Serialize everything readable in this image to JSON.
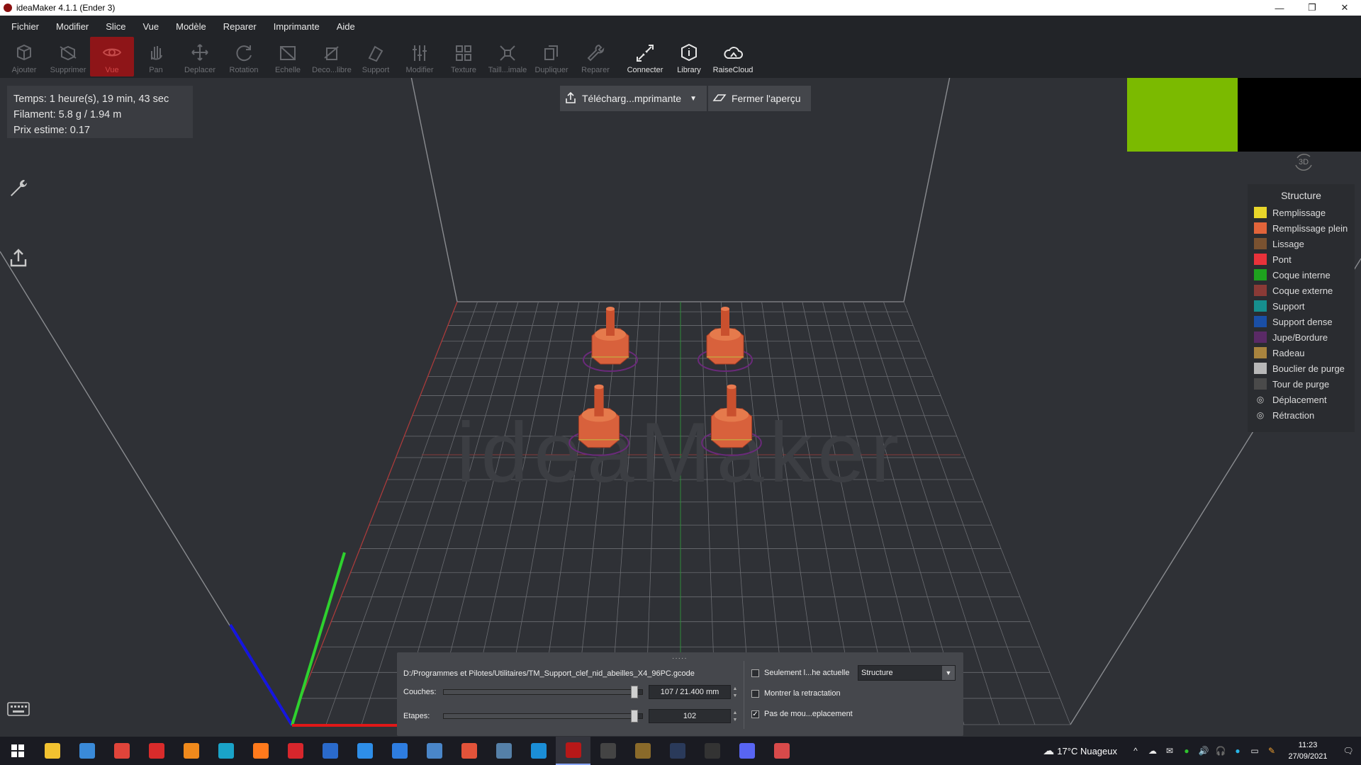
{
  "window": {
    "title": "ideaMaker 4.1.1 (Ender 3)",
    "controls": [
      "—",
      "❐",
      "✕"
    ]
  },
  "menu": [
    "Fichier",
    "Modifier",
    "Slice",
    "Vue",
    "Modèle",
    "Reparer",
    "Imprimante",
    "Aide"
  ],
  "toolbar": [
    {
      "label": "Ajouter",
      "icon": "add-model-icon",
      "state": "disabled"
    },
    {
      "label": "Supprimer",
      "icon": "delete-icon",
      "state": "disabled"
    },
    {
      "label": "Vue",
      "icon": "eye-icon",
      "state": "active"
    },
    {
      "label": "Pan",
      "icon": "hand-icon",
      "state": "disabled"
    },
    {
      "label": "Deplacer",
      "icon": "move-icon",
      "state": "disabled"
    },
    {
      "label": "Rotation",
      "icon": "rotate-icon",
      "state": "disabled"
    },
    {
      "label": "Echelle",
      "icon": "scale-icon",
      "state": "disabled"
    },
    {
      "label": "Deco...libre",
      "icon": "cut-icon",
      "state": "disabled"
    },
    {
      "label": "Support",
      "icon": "support-icon",
      "state": "disabled"
    },
    {
      "label": "Modifier",
      "icon": "sliders-icon",
      "state": "disabled"
    },
    {
      "label": "Texture",
      "icon": "texture-icon",
      "state": "disabled"
    },
    {
      "label": "Taill...imale",
      "icon": "minimal-size-icon",
      "state": "disabled"
    },
    {
      "label": "Dupliquer",
      "icon": "duplicate-icon",
      "state": "disabled"
    },
    {
      "label": "Reparer",
      "icon": "repair-icon",
      "state": "disabled"
    },
    {
      "label": "Connecter",
      "icon": "connect-icon",
      "state": "enabled"
    },
    {
      "label": "Library",
      "icon": "library-icon",
      "state": "enabled"
    },
    {
      "label": "RaiseCloud",
      "icon": "cloud-icon",
      "state": "enabled"
    }
  ],
  "info": {
    "time": "Temps: 1 heure(s), 19 min, 43 sec",
    "filament": "Filament: 5.8 g / 1.94 m",
    "price": "Prix estime: 0.17"
  },
  "preview_buttons": {
    "upload": "Télécharg...mprimante",
    "close": "Fermer l'aperçu"
  },
  "view_badge": "3D",
  "watermark": "ideaMaker",
  "legend": {
    "title": "Structure",
    "items": [
      {
        "label": "Remplissage",
        "color": "#e8d62a",
        "type": "swatch"
      },
      {
        "label": "Remplissage plein",
        "color": "#e2643a",
        "type": "swatch"
      },
      {
        "label": "Lissage",
        "color": "#7a5230",
        "type": "swatch"
      },
      {
        "label": "Pont",
        "color": "#e8323a",
        "type": "swatch"
      },
      {
        "label": "Coque interne",
        "color": "#1ea21e",
        "type": "swatch"
      },
      {
        "label": "Coque externe",
        "color": "#8a3a36",
        "type": "swatch"
      },
      {
        "label": "Support",
        "color": "#168e8e",
        "type": "swatch"
      },
      {
        "label": "Support dense",
        "color": "#1a4fa6",
        "type": "swatch"
      },
      {
        "label": "Jupe/Bordure",
        "color": "#5a2a66",
        "type": "swatch"
      },
      {
        "label": "Radeau",
        "color": "#a9843e",
        "type": "swatch"
      },
      {
        "label": "Bouclier de purge",
        "color": "#b8b8b8",
        "type": "swatch"
      },
      {
        "label": "Tour de purge",
        "color": "#4a4a4a",
        "type": "swatch"
      },
      {
        "label": "Déplacement",
        "color": "",
        "type": "eye"
      },
      {
        "label": "Rétraction",
        "color": "",
        "type": "eye"
      }
    ]
  },
  "bottom_panel": {
    "handle": "·····",
    "file_path": "D:/Programmes et Pilotes/Utilitaires/TM_Support_clef_nid_abeilles_X4_96PC.gcode",
    "layers_label": "Couches:",
    "layers_value": "107 / 21.400 mm",
    "layers_fraction": 1.0,
    "steps_label": "Etapes:",
    "steps_value": "102",
    "steps_fraction": 1.0,
    "options": [
      {
        "label": "Seulement l...he actuelle",
        "checked": false
      },
      {
        "label": "Montrer la retractation",
        "checked": false
      },
      {
        "label": "Pas de mou...eplacement",
        "checked": true
      }
    ],
    "display_mode": "Structure"
  },
  "taskbar": {
    "apps": [
      {
        "name": "file-explorer",
        "color": "#f2c230"
      },
      {
        "name": "control-panel",
        "color": "#3a8ad8"
      },
      {
        "name": "screenshot-tool",
        "color": "#e0443a"
      },
      {
        "name": "pdf-reader",
        "color": "#d92b2b"
      },
      {
        "name": "vlc",
        "color": "#f08a1c"
      },
      {
        "name": "edge",
        "color": "#1aa3c8"
      },
      {
        "name": "firefox",
        "color": "#ff7a1c"
      },
      {
        "name": "vivaldi",
        "color": "#d7262c"
      },
      {
        "name": "thunderbird",
        "color": "#2a6acb"
      },
      {
        "name": "document-app",
        "color": "#2e8ee8"
      },
      {
        "name": "store",
        "color": "#2e7de0"
      },
      {
        "name": "network-tool",
        "color": "#4a86c8"
      },
      {
        "name": "slicer-app",
        "color": "#e2533a"
      },
      {
        "name": "image-tool",
        "color": "#5580a8"
      },
      {
        "name": "c-app",
        "color": "#1b8ed6"
      },
      {
        "name": "ideamaker",
        "color": "#b71818"
      },
      {
        "name": "obs",
        "color": "#444444"
      },
      {
        "name": "terminal-app",
        "color": "#8a6a2a"
      },
      {
        "name": "steam",
        "color": "#2a3a5a"
      },
      {
        "name": "epic-games",
        "color": "#333333"
      },
      {
        "name": "discord",
        "color": "#5865f2"
      },
      {
        "name": "3d-app",
        "color": "#d84a4a"
      }
    ],
    "weather": "17°C  Nuageux",
    "time": "11:23",
    "date": "27/09/2021"
  }
}
